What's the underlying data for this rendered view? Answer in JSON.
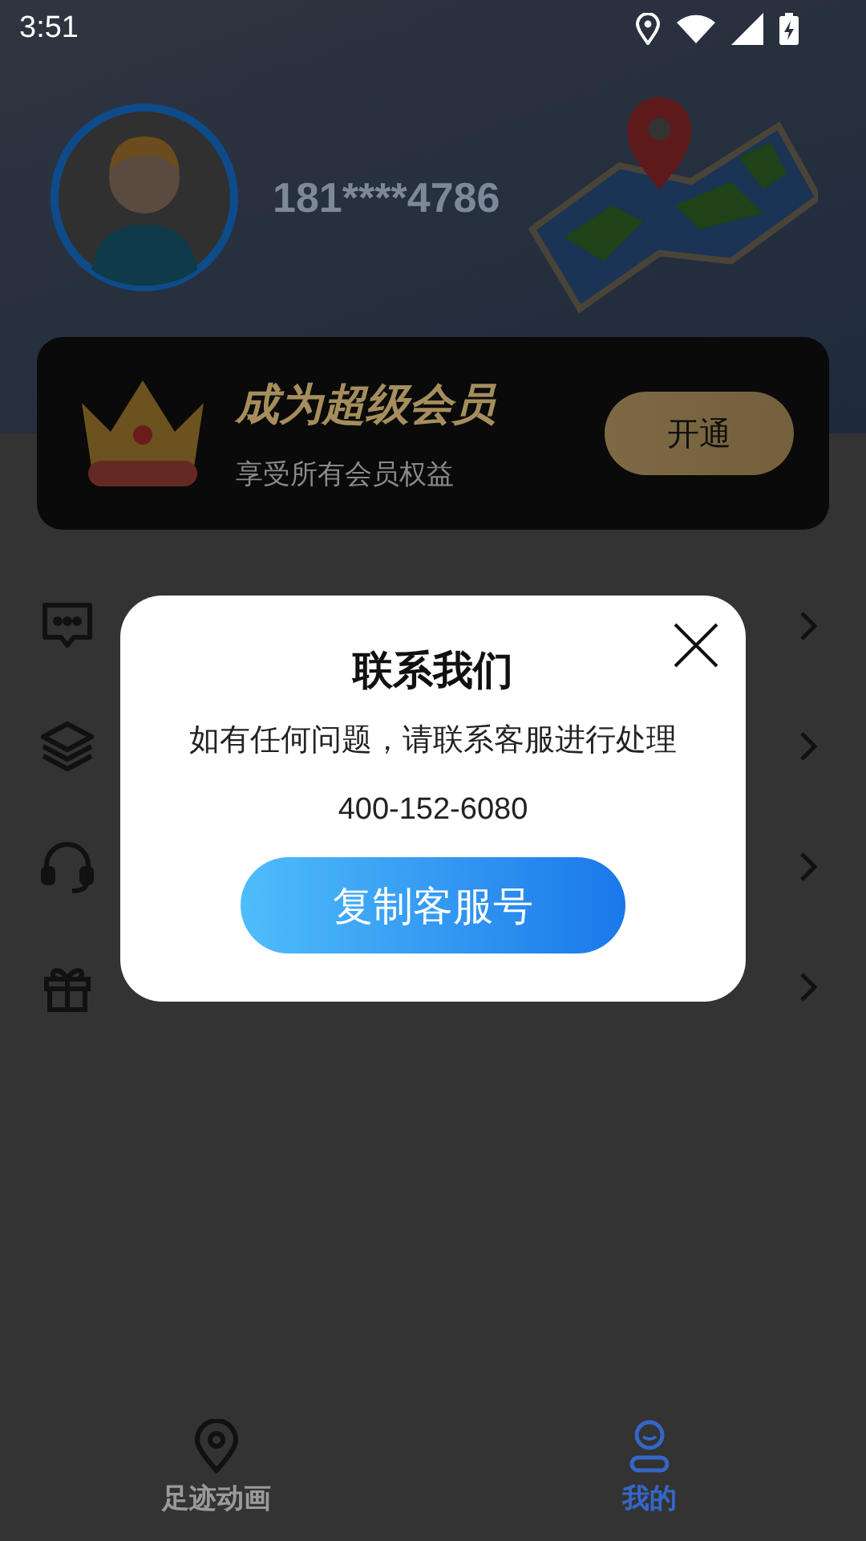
{
  "status_bar": {
    "time": "3:51"
  },
  "profile": {
    "phone": "181****4786"
  },
  "vip_card": {
    "title": "成为超级会员",
    "subtitle": "享受所有会员权益",
    "button": "开通"
  },
  "menu": [
    {
      "kind": "message"
    },
    {
      "kind": "layers"
    },
    {
      "kind": "headset"
    },
    {
      "kind": "gift"
    }
  ],
  "dialog": {
    "title": "联系我们",
    "message": "如有任何问题，请联系客服进行处理",
    "phone": "400-152-6080",
    "button": "复制客服号"
  },
  "bottom_nav": [
    {
      "label": "足迹动画",
      "kind": "pin",
      "selected": false
    },
    {
      "label": "我的",
      "kind": "person",
      "selected": true
    }
  ]
}
